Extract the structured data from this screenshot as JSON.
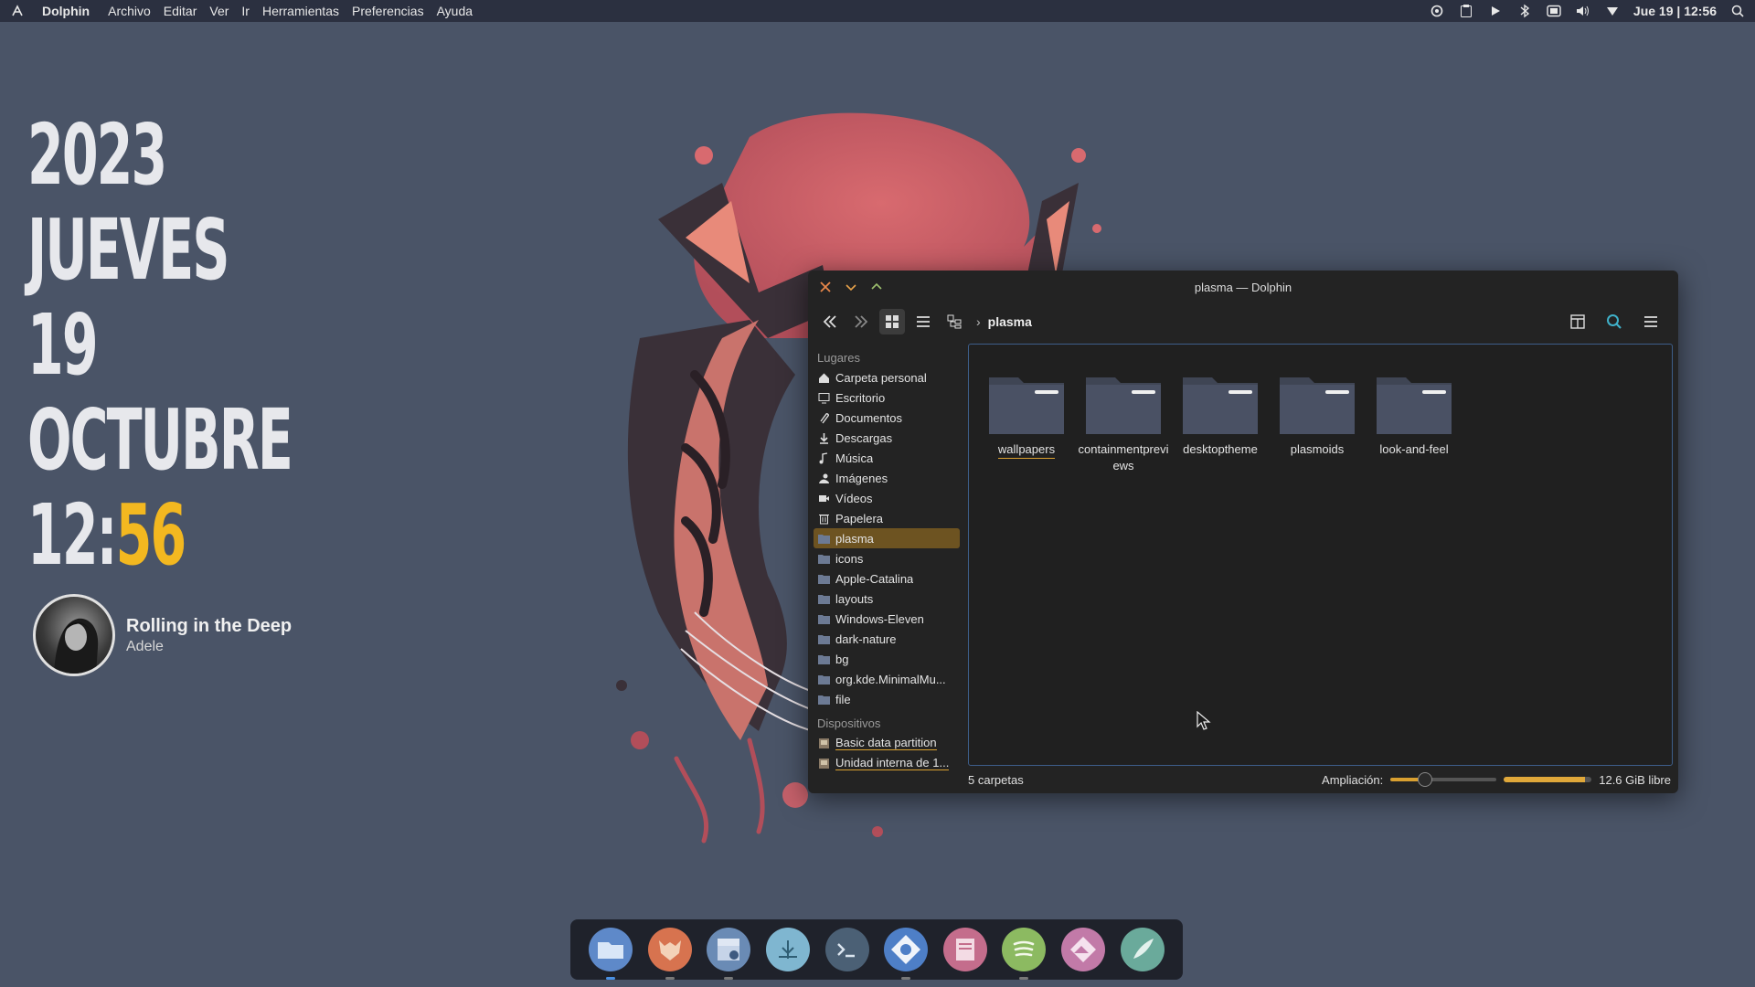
{
  "topbar": {
    "app_name": "Dolphin",
    "menus": [
      "Archivo",
      "Editar",
      "Ver",
      "Ir",
      "Herramientas",
      "Preferencias",
      "Ayuda"
    ],
    "clock": "Jue 19 | 12:56"
  },
  "date_widget": {
    "year": "2023",
    "weekday": "JUEVES",
    "day": "19",
    "month": "OCTUBRE",
    "time_hours": "12:",
    "time_minutes": "56",
    "accent_color": "#f3b820"
  },
  "media": {
    "song": "Rolling in the Deep",
    "artist": "Adele"
  },
  "window": {
    "title": "plasma — Dolphin",
    "breadcrumb": "plasma",
    "places_header": "Lugares",
    "places": [
      {
        "label": "Carpeta personal",
        "icon": "home-icon"
      },
      {
        "label": "Escritorio",
        "icon": "desktop-icon"
      },
      {
        "label": "Documentos",
        "icon": "document-icon"
      },
      {
        "label": "Descargas",
        "icon": "download-icon"
      },
      {
        "label": "Música",
        "icon": "music-icon"
      },
      {
        "label": "Imágenes",
        "icon": "image-icon"
      },
      {
        "label": "Vídeos",
        "icon": "video-icon"
      },
      {
        "label": "Papelera",
        "icon": "trash-icon"
      },
      {
        "label": "plasma",
        "icon": "folder-icon"
      },
      {
        "label": "icons",
        "icon": "folder-icon"
      },
      {
        "label": "Apple-Catalina",
        "icon": "folder-icon"
      },
      {
        "label": "layouts",
        "icon": "folder-icon"
      },
      {
        "label": "Windows-Eleven",
        "icon": "folder-icon"
      },
      {
        "label": "dark-nature",
        "icon": "folder-icon"
      },
      {
        "label": "bg",
        "icon": "folder-icon"
      },
      {
        "label": "org.kde.MinimalMu...",
        "icon": "folder-icon"
      },
      {
        "label": "file",
        "icon": "folder-icon"
      }
    ],
    "devices_header": "Dispositivos",
    "devices": [
      {
        "label": "Basic data partition",
        "icon": "drive-icon"
      },
      {
        "label": "Unidad interna de 1...",
        "icon": "drive-icon"
      }
    ],
    "folders": [
      "wallpapers",
      "containmentpreviews",
      "desktoptheme",
      "plasmoids",
      "look-and-feel"
    ],
    "status_count": "5 carpetas",
    "zoom_label": "Ampliación:",
    "zoom_fraction": 0.3,
    "free_space": "12.6 GiB libre",
    "disk_used_fraction": 0.92,
    "selection_color": "#6d5321",
    "accent_color": "#d9a030"
  },
  "dock": {
    "apps": [
      {
        "name": "files",
        "color": "#5e89c9",
        "running": true,
        "active": true
      },
      {
        "name": "firefox",
        "color": "#d7734f",
        "running": true
      },
      {
        "name": "store",
        "color": "#6a8bb5",
        "running": true
      },
      {
        "name": "image-viewer",
        "color": "#7fb6d0"
      },
      {
        "name": "terminal",
        "color": "#4b6075"
      },
      {
        "name": "kde-connect",
        "color": "#4e7fc7",
        "running": true
      },
      {
        "name": "notes",
        "color": "#c46d8c"
      },
      {
        "name": "spotify",
        "color": "#8cba61",
        "running": true
      },
      {
        "name": "affinity",
        "color": "#c27aa8"
      },
      {
        "name": "vscode",
        "color": "#6aaa9b"
      }
    ]
  }
}
